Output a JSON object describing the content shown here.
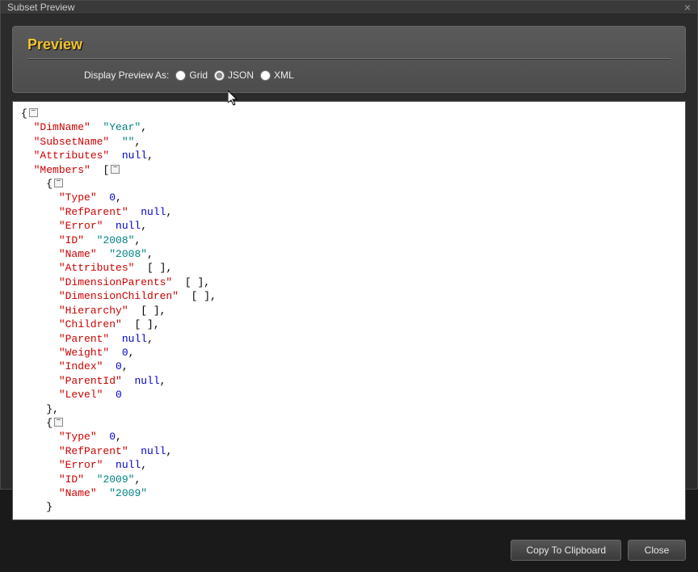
{
  "titlebar": {
    "title": "Subset Preview",
    "close": "×"
  },
  "header": {
    "title": "Preview",
    "display_label": "Display Preview As:",
    "options": {
      "grid": "Grid",
      "json": "JSON",
      "xml": "XML"
    },
    "selected": "json"
  },
  "footer": {
    "copy": "Copy To Clipboard",
    "close": "Close"
  },
  "json_preview": {
    "DimName": "Year",
    "SubsetName": "",
    "Attributes": null,
    "Members": [
      {
        "Type": 0,
        "RefParent": null,
        "Error": null,
        "ID": "2008",
        "Name": "2008",
        "Attributes": [],
        "DimensionParents": [],
        "DimensionChildren": [],
        "Hierarchy": [],
        "Children": [],
        "Parent": null,
        "Weight": 0,
        "Index": 0,
        "ParentId": null,
        "Level": 0
      },
      {
        "Type": 0,
        "RefParent": null,
        "Error": null,
        "ID": "2009",
        "Name": "2009"
      }
    ]
  }
}
